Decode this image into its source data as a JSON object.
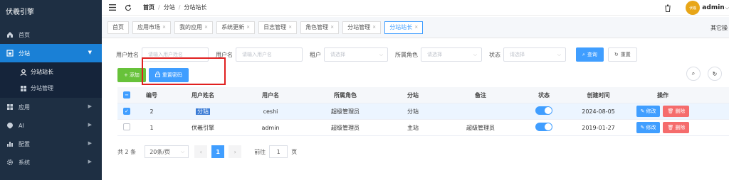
{
  "brand": "伏羲引擎",
  "sidebar": {
    "items": [
      {
        "label": "首页",
        "icon": "home-icon"
      },
      {
        "label": "分站",
        "icon": "station-icon",
        "active": true
      },
      {
        "label": "应用",
        "icon": "grid-icon"
      },
      {
        "label": "AI",
        "icon": "ai-icon"
      },
      {
        "label": "配置",
        "icon": "chart-icon"
      },
      {
        "label": "系统",
        "icon": "gear-icon"
      }
    ],
    "sub_items": [
      {
        "label": "分站站长",
        "icon": "user-icon"
      },
      {
        "label": "分站管理",
        "icon": "grid-icon"
      }
    ]
  },
  "header": {
    "breadcrumb": [
      "首页",
      "分站",
      "分站站长"
    ],
    "username": "admin",
    "avatar_text": "伏羲"
  },
  "tags": {
    "items": [
      "首页",
      "应用市场",
      "我的应用",
      "系统更新",
      "日志管理",
      "角色管理",
      "分站管理",
      "分站站长"
    ],
    "more": "其它操"
  },
  "search": {
    "username_label": "用户姓名",
    "username_placeholder": "请输入用户姓名",
    "login_label": "用户名",
    "login_placeholder": "请输入用户名",
    "tenant_label": "租户",
    "tenant_placeholder": "请选择",
    "role_label": "所属角色",
    "role_placeholder": "请选择",
    "status_label": "状态",
    "status_placeholder": "请选择",
    "query_button": "查询",
    "reset_button": "重置"
  },
  "toolbar": {
    "add_button": "添加",
    "reset_password_button": "重置密码"
  },
  "table": {
    "headers": [
      "编号",
      "用户姓名",
      "用户名",
      "所属角色",
      "分站",
      "备注",
      "状态",
      "创建时间",
      "操作"
    ],
    "rows": [
      {
        "id": "2",
        "name": "分站",
        "username": "ceshi",
        "role": "超级管理员",
        "station": "分站",
        "remark": "",
        "created": "2024-08-05",
        "selected": true
      },
      {
        "id": "1",
        "name": "伏羲引擎",
        "username": "admin",
        "role": "超级管理员",
        "station": "主站",
        "remark": "超级管理员",
        "created": "2019-01-27",
        "selected": false
      }
    ],
    "edit_label": "修改",
    "delete_label": "删除"
  },
  "pagination": {
    "total": "共 2 条",
    "page_size": "20条/页",
    "current_page": "1",
    "goto_label": "前往",
    "goto_value": "1",
    "page_suffix": "页"
  },
  "colors": {
    "sidebar_bg": "#1e2f43",
    "accent": "#409eff",
    "success": "#67c23a",
    "danger": "#f56c6c",
    "highlight_box": "#e02020"
  }
}
